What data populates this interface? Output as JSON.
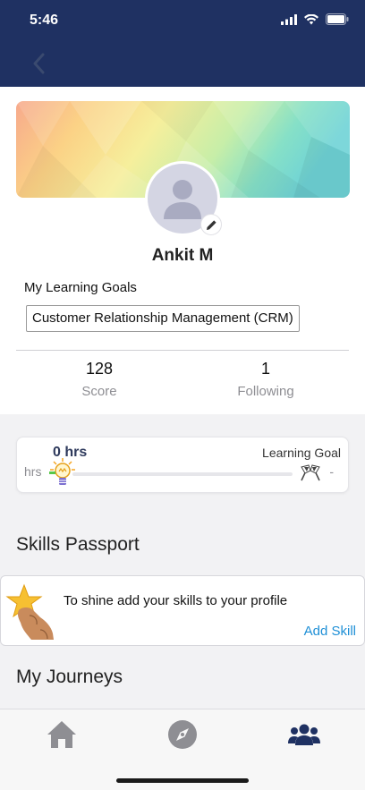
{
  "status_bar": {
    "time": "5:46"
  },
  "profile": {
    "name": "Ankit M",
    "learning_goals_label": "My Learning Goals",
    "learning_goals": [
      "Customer Relationship Management (CRM)"
    ],
    "stats": {
      "score_value": "128",
      "score_label": "Score",
      "following_value": "1",
      "following_label": "Following"
    }
  },
  "progress": {
    "hours": "0 hrs",
    "goal_label": "Learning Goal",
    "unit": "hrs",
    "goal_value": "-",
    "fraction": 0
  },
  "skills_passport": {
    "title": "Skills Passport",
    "message": "To shine add your skills to your profile",
    "add_label": "Add Skill"
  },
  "journeys": {
    "title": "My Journeys"
  },
  "tabs": [
    {
      "icon": "home-icon",
      "active": false
    },
    {
      "icon": "compass-icon",
      "active": false
    },
    {
      "icon": "people-icon",
      "active": true
    }
  ],
  "colors": {
    "header": "#1f3162",
    "accent": "#1e8fd6",
    "active_tab": "#1f3162",
    "inactive_tab": "#8e8e93"
  }
}
